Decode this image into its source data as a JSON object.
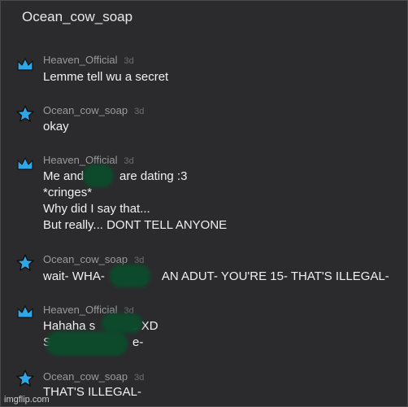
{
  "header": {
    "title": "Ocean_cow_soap"
  },
  "messages": [
    {
      "author": "Heaven_Official",
      "time": "3d",
      "avatar_icon": "crown-icon",
      "lines": [
        "Lemme tell wu a secret"
      ]
    },
    {
      "author": "Ocean_cow_soap",
      "time": "3d",
      "avatar_icon": "star-icon",
      "lines": [
        "okay"
      ]
    },
    {
      "author": "Heaven_Official",
      "time": "3d",
      "avatar_icon": "crown-icon",
      "lines": [
        "Me and",
        "are dating :3",
        "*cringes*",
        "Why did I say that...",
        "But really... DONT TELL ANYONE"
      ]
    },
    {
      "author": "Ocean_cow_soap",
      "time": "3d",
      "avatar_icon": "star-icon",
      "lines": [
        "wait- WHA-",
        "AN ADUT- YOU'RE 15- THAT'S ILLEGAL-"
      ]
    },
    {
      "author": "Heaven_Official",
      "time": "3d",
      "avatar_icon": "crown-icon",
      "lines": [
        "Hahaha s",
        "3 XD",
        "S",
        "e-"
      ]
    },
    {
      "author": "Ocean_cow_soap",
      "time": "3d",
      "avatar_icon": "star-icon",
      "lines": [
        "THAT'S ILLEGAL-"
      ]
    }
  ],
  "watermark": "imgflip.com",
  "colors": {
    "background": "#2b2b2d",
    "icon_blue": "#2fa6e6",
    "redaction": "#0d4a2c"
  }
}
